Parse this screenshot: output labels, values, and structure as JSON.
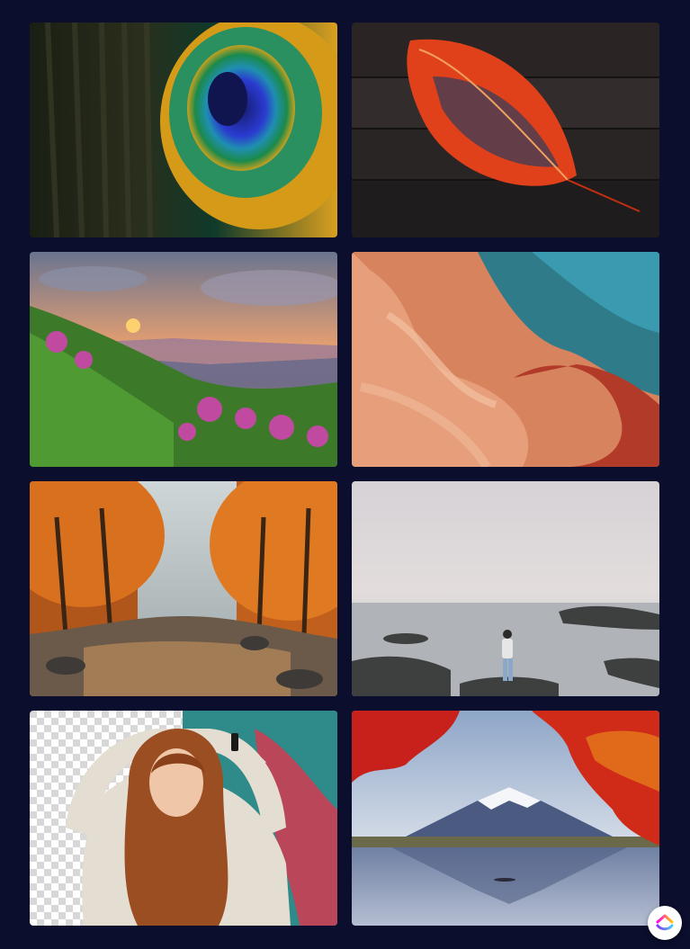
{
  "gallery": {
    "items": [
      {
        "id": "peacock-feather",
        "alt": ""
      },
      {
        "id": "red-leaf-on-wood",
        "alt": ""
      },
      {
        "id": "mountain-sunset-flowers",
        "alt": ""
      },
      {
        "id": "orange-blue-swirl",
        "alt": ""
      },
      {
        "id": "autumn-forest-river",
        "alt": ""
      },
      {
        "id": "woman-on-rocky-shore",
        "alt": ""
      },
      {
        "id": "woman-sweater-transparent-bg",
        "alt": ""
      },
      {
        "id": "mount-fuji-autumn",
        "alt": ""
      }
    ]
  },
  "colors": {
    "page_background": "#0b0e2c",
    "fab_background": "#ffffff"
  },
  "icons": {
    "fab": "clickup-logo-icon"
  }
}
